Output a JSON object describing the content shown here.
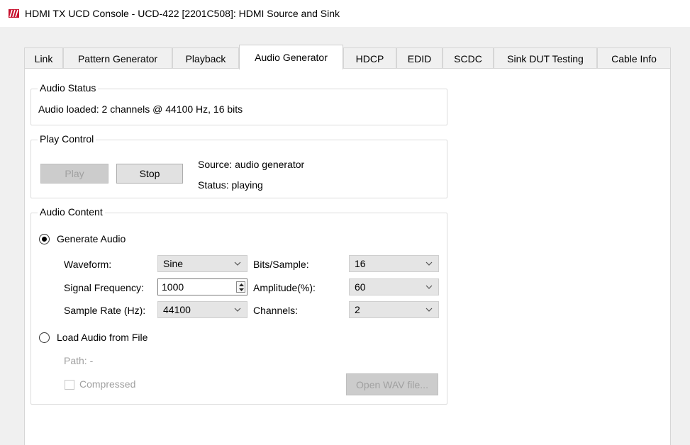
{
  "window": {
    "title": "HDMI TX UCD Console - UCD-422 [2201C508]: HDMI Source and Sink",
    "logo_color": "#c8102e"
  },
  "tabs": [
    {
      "label": "Link",
      "active": false
    },
    {
      "label": "Pattern Generator",
      "active": false
    },
    {
      "label": "Playback",
      "active": false
    },
    {
      "label": "Audio Generator",
      "active": true
    },
    {
      "label": "HDCP",
      "active": false
    },
    {
      "label": "EDID",
      "active": false
    },
    {
      "label": "SCDC",
      "active": false
    },
    {
      "label": "Sink DUT Testing",
      "active": false
    },
    {
      "label": "Cable Info",
      "active": false
    }
  ],
  "audio_status": {
    "title": "Audio Status",
    "text": "Audio loaded:  2 channels @ 44100 Hz, 16 bits"
  },
  "play_control": {
    "title": "Play Control",
    "play_label": "Play",
    "stop_label": "Stop",
    "source_text": "Source:  audio generator",
    "status_text": "Status:  playing"
  },
  "audio_content": {
    "title": "Audio Content",
    "generate_label": "Generate Audio",
    "generate_selected": true,
    "waveform_label": "Waveform:",
    "waveform_value": "Sine",
    "frequency_label": "Signal Frequency:",
    "frequency_value": "1000",
    "sample_rate_label": "Sample Rate (Hz):",
    "sample_rate_value": "44100",
    "bits_label": "Bits/Sample:",
    "bits_value": "16",
    "amplitude_label": "Amplitude(%):",
    "amplitude_value": "60",
    "channels_label": "Channels:",
    "channels_value": "2",
    "load_file_label": "Load Audio from File",
    "load_file_selected": false,
    "path_text": "Path:  -",
    "compressed_label": "Compressed",
    "compressed_checked": false,
    "open_wav_label": "Open WAV file..."
  }
}
